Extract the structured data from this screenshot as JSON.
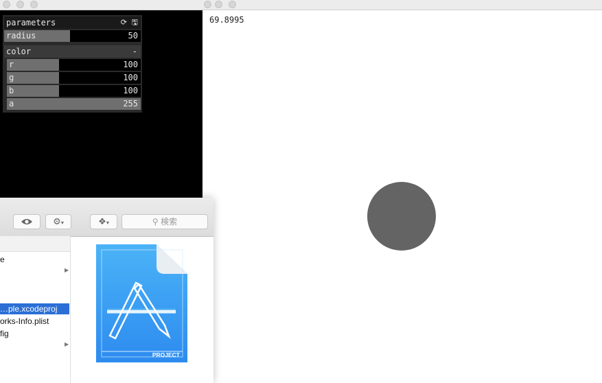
{
  "gui": {
    "panel_title": "parameters",
    "header_icons": "⟳ 🖫",
    "radius": {
      "label": "radius",
      "value": "50",
      "fraction": 0.48
    },
    "group": {
      "label": "color",
      "toggle": "-"
    },
    "sliders": [
      {
        "label": "r",
        "value": "100",
        "fraction": 0.39
      },
      {
        "label": "g",
        "value": "100",
        "fraction": 0.39
      },
      {
        "label": "b",
        "value": "100",
        "fraction": 0.39
      },
      {
        "label": "a",
        "value": "255",
        "fraction": 1.0
      }
    ]
  },
  "output": {
    "fps": "69.8995",
    "circle_color": "#646464"
  },
  "finder": {
    "search_placeholder": "検索",
    "files": [
      {
        "name": "e",
        "selected": false
      },
      {
        "name": "",
        "selected": false,
        "disclosure": "▶"
      },
      {
        "name": "",
        "selected": false
      },
      {
        "name": "…ple.xcodeproj",
        "selected": true
      },
      {
        "name": "orks-Info.plist",
        "selected": false
      },
      {
        "name": "fig",
        "selected": false
      },
      {
        "name": "",
        "selected": false,
        "disclosure": "▶"
      }
    ],
    "preview_badge": "PROJECT"
  }
}
